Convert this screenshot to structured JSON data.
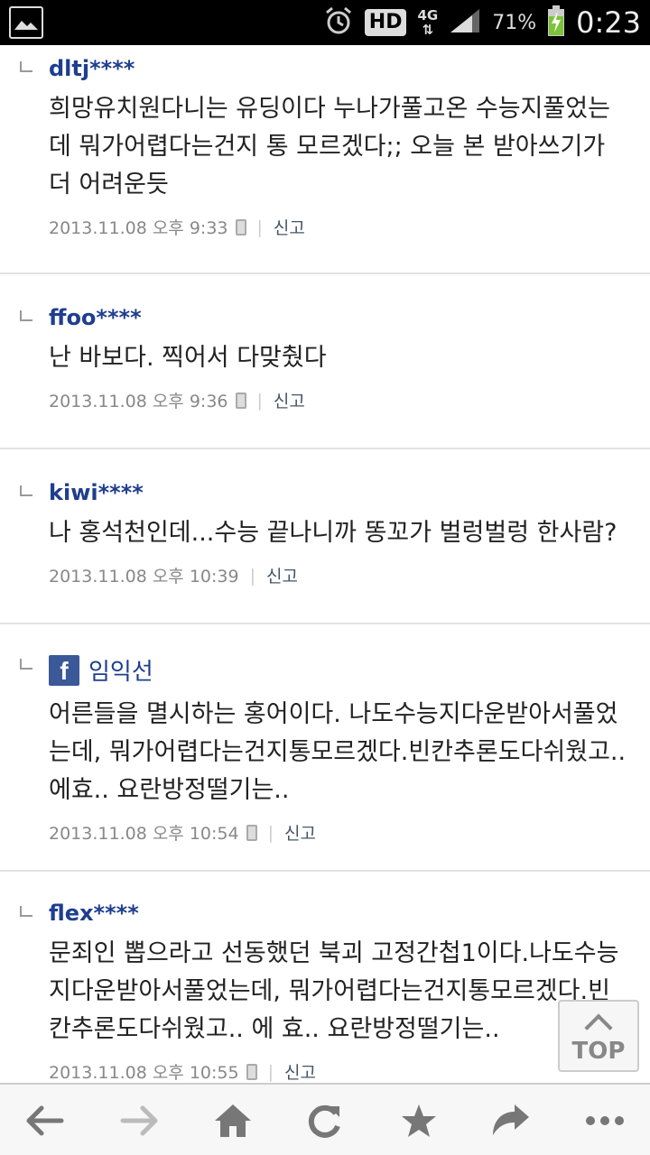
{
  "status_bar": {
    "network": "4G",
    "hd": "HD",
    "battery": "71%",
    "time": "0:23"
  },
  "comments": [
    {
      "author": "dltj****",
      "text": "희망유치원다니는 유딩이다 누나가풀고온 수능지풀었는데 뭐가어렵다는건지 통 모르겠다;; 오늘 본 받아쓰기가 더 어려운듯",
      "date": "2013.11.08 오후 9:33",
      "mobile": true,
      "report": "신고"
    },
    {
      "author": "ffoo****",
      "text": "난 바보다. 찍어서 다맞췄다",
      "date": "2013.11.08 오후 9:36",
      "mobile": true,
      "report": "신고"
    },
    {
      "author": "kiwi****",
      "text": "나 홍석천인데...수능 끝나니까 똥꼬가 벌렁벌렁 한사람?",
      "date": "2013.11.08 오후 10:39",
      "mobile": false,
      "report": "신고"
    },
    {
      "author": "임익선",
      "facebook": true,
      "text": "어른들을 멸시하는 홍어이다. 나도수능지다운받아서풀었는데, 뭐가어렵다는건지통모르겠다.빈칸추론도다쉬웠고.. 에효.. 요란방정떨기는..",
      "date": "2013.11.08 오후 10:54",
      "mobile": true,
      "report": "신고"
    },
    {
      "author": "flex****",
      "text": "문죄인 뽑으라고 선동했던 북괴 고정간첩1이다.나도수능지다운받아서풀었는데, 뭐가어렵다는건지통모르겠다.빈칸추론도다쉬웠고.. 에 효.. 요란방정떨기는..",
      "date": "2013.11.08 오후 10:55",
      "mobile": true,
      "report": "신고"
    }
  ],
  "top_button": {
    "label": "TOP"
  },
  "colors": {
    "author": "#1f3e8f",
    "facebook": "#3b5998",
    "meta": "#888888"
  }
}
